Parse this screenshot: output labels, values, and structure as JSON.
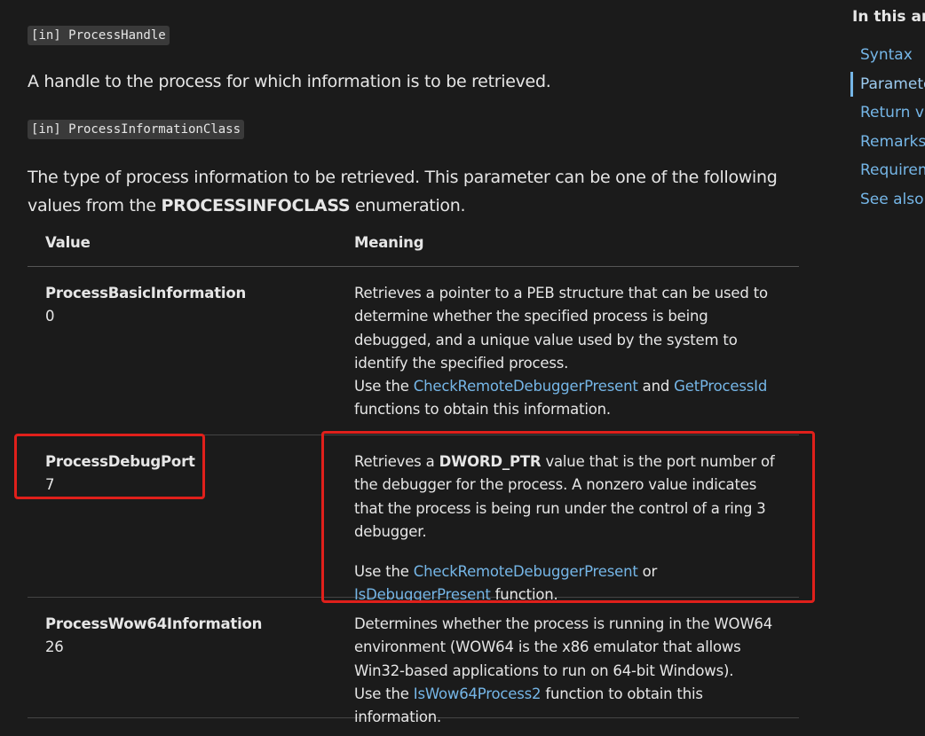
{
  "params": [
    {
      "tag": "[in] ProcessHandle",
      "description": "A handle to the process for which information is to be retrieved."
    },
    {
      "tag": "[in] ProcessInformationClass",
      "description_pre": "The type of process information to be retrieved. This parameter can be one of the following values from the ",
      "description_bold": "PROCESSINFOCLASS",
      "description_post": " enumeration."
    }
  ],
  "table": {
    "headers": {
      "value": "Value",
      "meaning": "Meaning"
    },
    "rows": [
      {
        "name": "ProcessBasicInformation",
        "number": "0",
        "meaning": {
          "text1": "Retrieves a pointer to a PEB structure that can be used to determine whether the specified process is being debugged, and a unique value used by the system to identify the specified process.",
          "use_pre": "Use the ",
          "link1": "CheckRemoteDebuggerPresent",
          "use_mid": " and ",
          "link2": "GetProcessId",
          "use_post": " functions to obtain this information."
        }
      },
      {
        "name": "ProcessDebugPort",
        "number": "7",
        "meaning": {
          "text_pre": "Retrieves a ",
          "text_bold": "DWORD_PTR",
          "text_post": " value that is the port number of the debugger for the process. A nonzero value indicates that the process is being run under the control of a ring 3 debugger.",
          "use_pre": "Use the ",
          "link1": "CheckRemoteDebuggerPresent",
          "use_mid": " or ",
          "link2": "IsDebuggerPresent",
          "use_post": " function."
        }
      },
      {
        "name": "ProcessWow64Information",
        "number": "26",
        "meaning": {
          "text1": "Determines whether the process is running in the WOW64 environment (WOW64 is the x86 emulator that allows Win32-based applications to run on 64-bit Windows).",
          "use_pre": "Use the ",
          "link1": "IsWow64Process2",
          "use_post": " function to obtain this information."
        }
      }
    ]
  },
  "sidebar": {
    "heading": "In this article",
    "items": [
      "Syntax",
      "Parameters",
      "Return value",
      "Remarks",
      "Requirements",
      "See also"
    ],
    "active_index": 1
  },
  "colors": {
    "background": "#1b1b1b",
    "text": "#e6e6e6",
    "link": "#75b6e7",
    "highlight": "#e0201b"
  }
}
